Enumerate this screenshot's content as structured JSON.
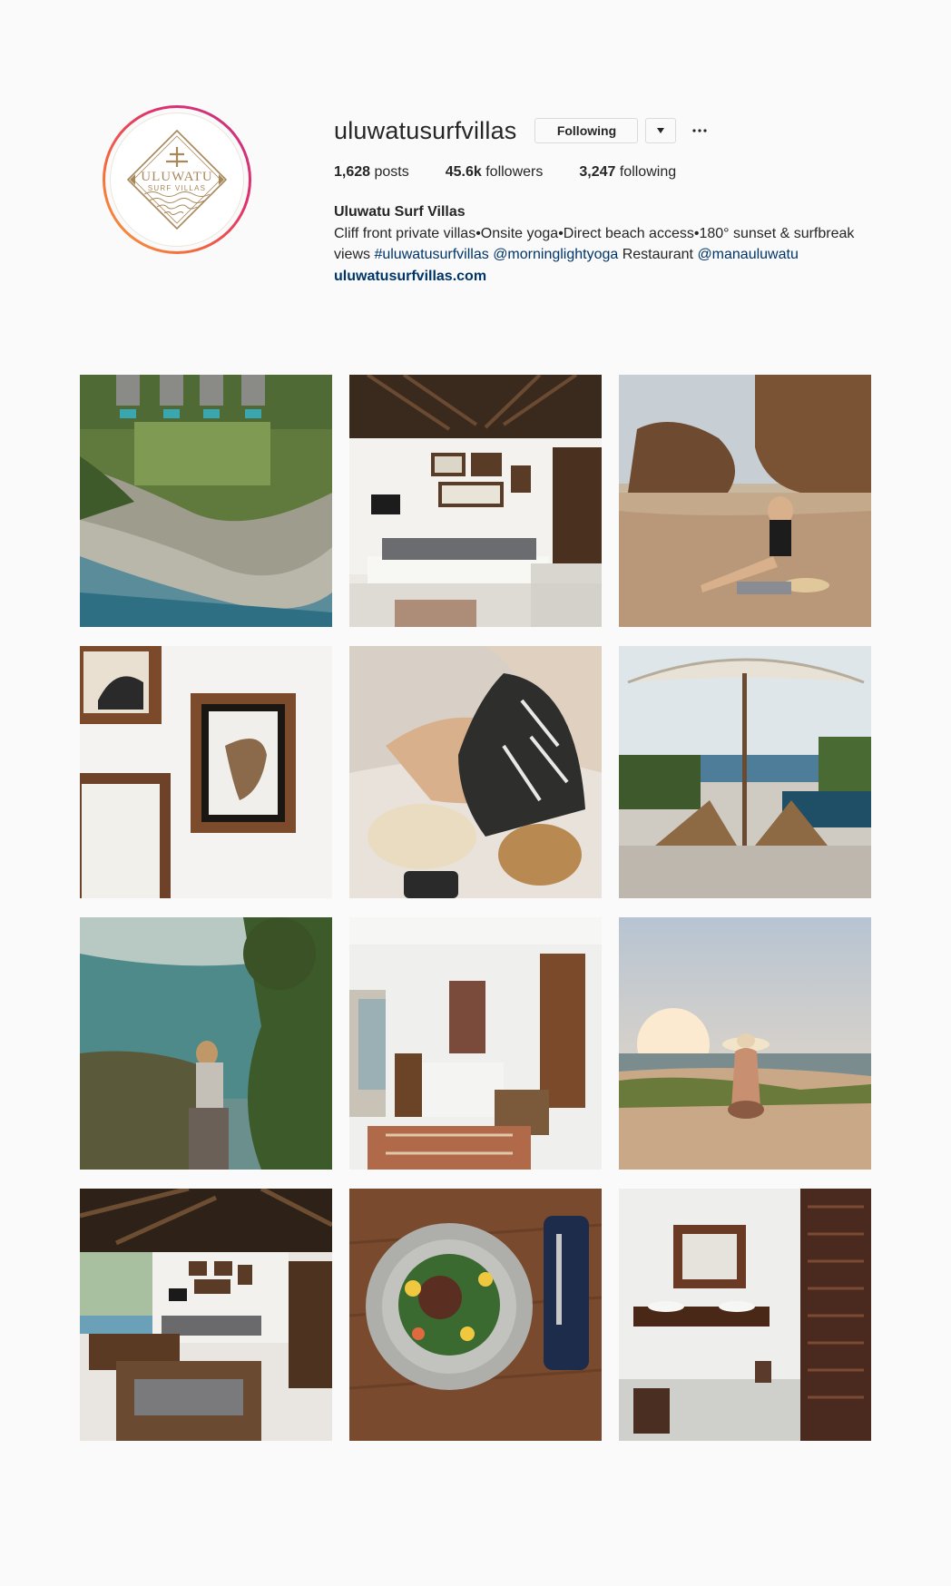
{
  "profile": {
    "username": "uluwatusurfvillas",
    "following_button": "Following",
    "dropdown_icon": "triangle-down-icon",
    "more_icon": "ellipsis-icon",
    "avatar_logo_top": "ULUWATU",
    "avatar_logo_bottom": "SURF VILLAS",
    "stats": {
      "posts_count": "1,628",
      "posts_label": " posts",
      "followers_count": "45.6k",
      "followers_label": " followers",
      "following_count": "3,247",
      "following_label": " following"
    },
    "bio": {
      "name": "Uluwatu Surf Villas",
      "text1": "Cliff front private villas•Onsite yoga•Direct beach access•180° sunset & surfbreak views ",
      "hashtag": "#uluwatusurfvillas",
      "mention1": "@morninglightyoga",
      "text2": " Restaurant ",
      "mention2": "@manauluwatu",
      "website": "uluwatusurfvillas.com"
    }
  },
  "colors": {
    "link": "#003569",
    "ring_start": "#f9a03f",
    "ring_end": "#c13584",
    "logo": "#a8885a"
  },
  "posts": [
    {
      "subject": "aerial-villas-coast"
    },
    {
      "subject": "living-room-interior"
    },
    {
      "subject": "woman-on-beach-rocks"
    },
    {
      "subject": "framed-surf-art"
    },
    {
      "subject": "beach-dress-hat"
    },
    {
      "subject": "pool-umbrella-loungers"
    },
    {
      "subject": "cliff-path-view"
    },
    {
      "subject": "bedroom-interior"
    },
    {
      "subject": "sunset-beach-hat"
    },
    {
      "subject": "open-living-area"
    },
    {
      "subject": "salad-plate"
    },
    {
      "subject": "bathroom-vanity"
    }
  ]
}
